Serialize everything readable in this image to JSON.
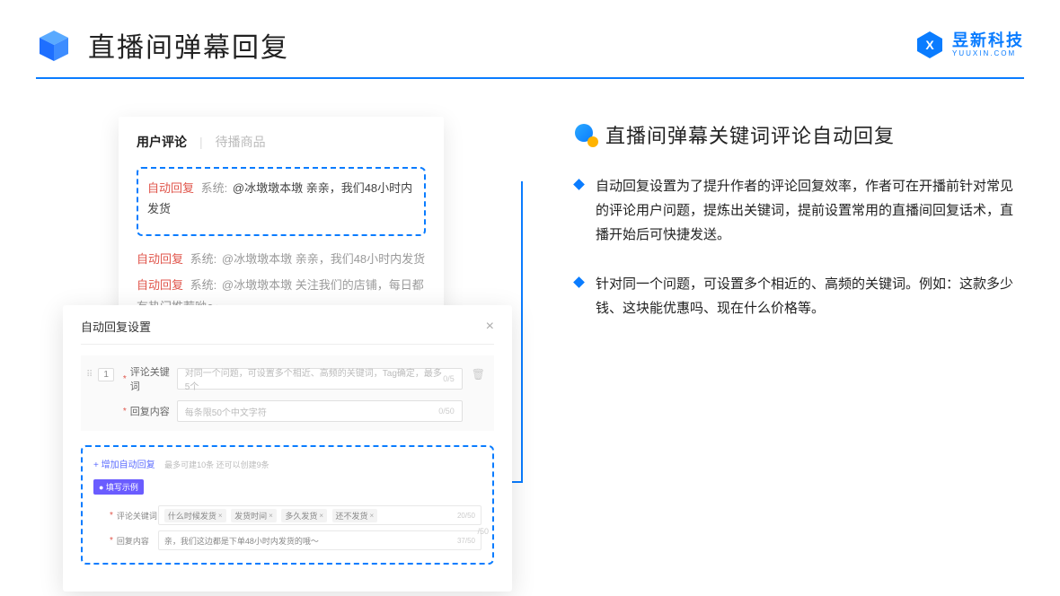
{
  "header": {
    "title": "直播间弹幕回复",
    "logo_main": "昱新科技",
    "logo_sub": "YUUXIN.COM"
  },
  "comment_card": {
    "tab_active": "用户评论",
    "tab_inactive": "待播商品",
    "auto_reply_label": "自动回复",
    "system_label": "系统:",
    "highlighted_comment": "@冰墩墩本墩 亲亲，我们48小时内发货",
    "comment2": "@冰墩墩本墩 亲亲，我们48小时内发货",
    "comment3": "@冰墩墩本墩 关注我们的店铺，每日都有热门推荐呦～"
  },
  "settings": {
    "title": "自动回复设置",
    "order": "1",
    "keyword_label": "评论关键词",
    "keyword_placeholder": "对同一个问题，可设置多个相近、高频的关键词，Tag确定，最多5个",
    "keyword_counter": "0/5",
    "content_label": "回复内容",
    "content_placeholder": "每条限50个中文字符",
    "content_counter": "0/50",
    "add_link": "+ 增加自动回复",
    "add_note": "最多可建10条 还可以创建9条",
    "example_badge": "● 填写示例",
    "ex_keyword_label": "评论关键词",
    "ex_tags": [
      "什么时候发货",
      "发货时间",
      "多久发货",
      "还不发货"
    ],
    "ex_keyword_counter": "20/50",
    "ex_content_label": "回复内容",
    "ex_content_value": "亲，我们这边都是下单48小时内发货的哦～",
    "ex_content_counter": "37/50",
    "outer_counter": "/50"
  },
  "right": {
    "section_title": "直播间弹幕关键词评论自动回复",
    "bullet1": "自动回复设置为了提升作者的评论回复效率，作者可在开播前针对常见的评论用户问题，提炼出关键词，提前设置常用的直播间回复话术，直播开始后可快捷发送。",
    "bullet2": "针对同一个问题，可设置多个相近的、高频的关键词。例如：这款多少钱、这块能优惠吗、现在什么价格等。"
  }
}
